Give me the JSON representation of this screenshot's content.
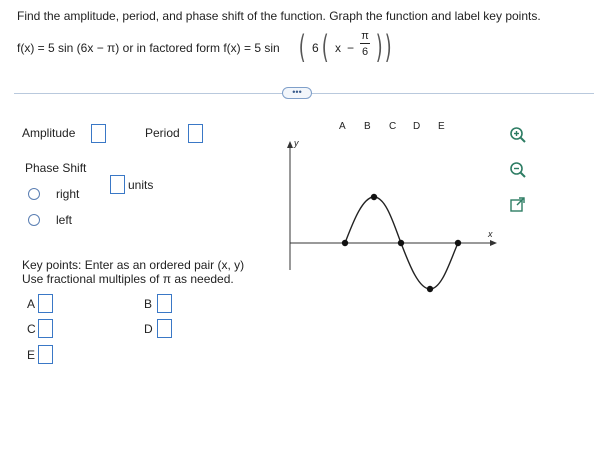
{
  "question": {
    "instruction": "Find the amplitude, period, and phase shift of the function. Graph the function and label key points.",
    "function_prefix": "f(x) = 5 sin (6x − π) or in factored form f(x) = 5 sin",
    "factored_six": "6",
    "factored_x": "x",
    "factored_minus": "−",
    "pi_numerator": "π",
    "six_denominator": "6"
  },
  "more_button": {
    "label": "•••"
  },
  "answers": {
    "amplitude_label": "Amplitude",
    "period_label": "Period",
    "phase_shift_label": "Phase Shift",
    "units_label": "units",
    "radio_right": "right",
    "radio_left": "left",
    "key_points_line1": "Key points:  Enter as an ordered pair (x, y)",
    "key_points_line2": "Use fractional multiples of π as needed.",
    "point_labels": [
      "A",
      "B",
      "C",
      "D",
      "E"
    ]
  },
  "graph": {
    "axis_x_label": "x",
    "axis_y_label": "y",
    "point_letters": [
      "A",
      "B",
      "C",
      "D",
      "E"
    ],
    "curve_color": "#222222",
    "point_color": "#111111"
  },
  "tools": {
    "icons": [
      "zoom-in-icon",
      "zoom-out-icon",
      "expand-icon"
    ],
    "accent": "#2e7d64"
  }
}
